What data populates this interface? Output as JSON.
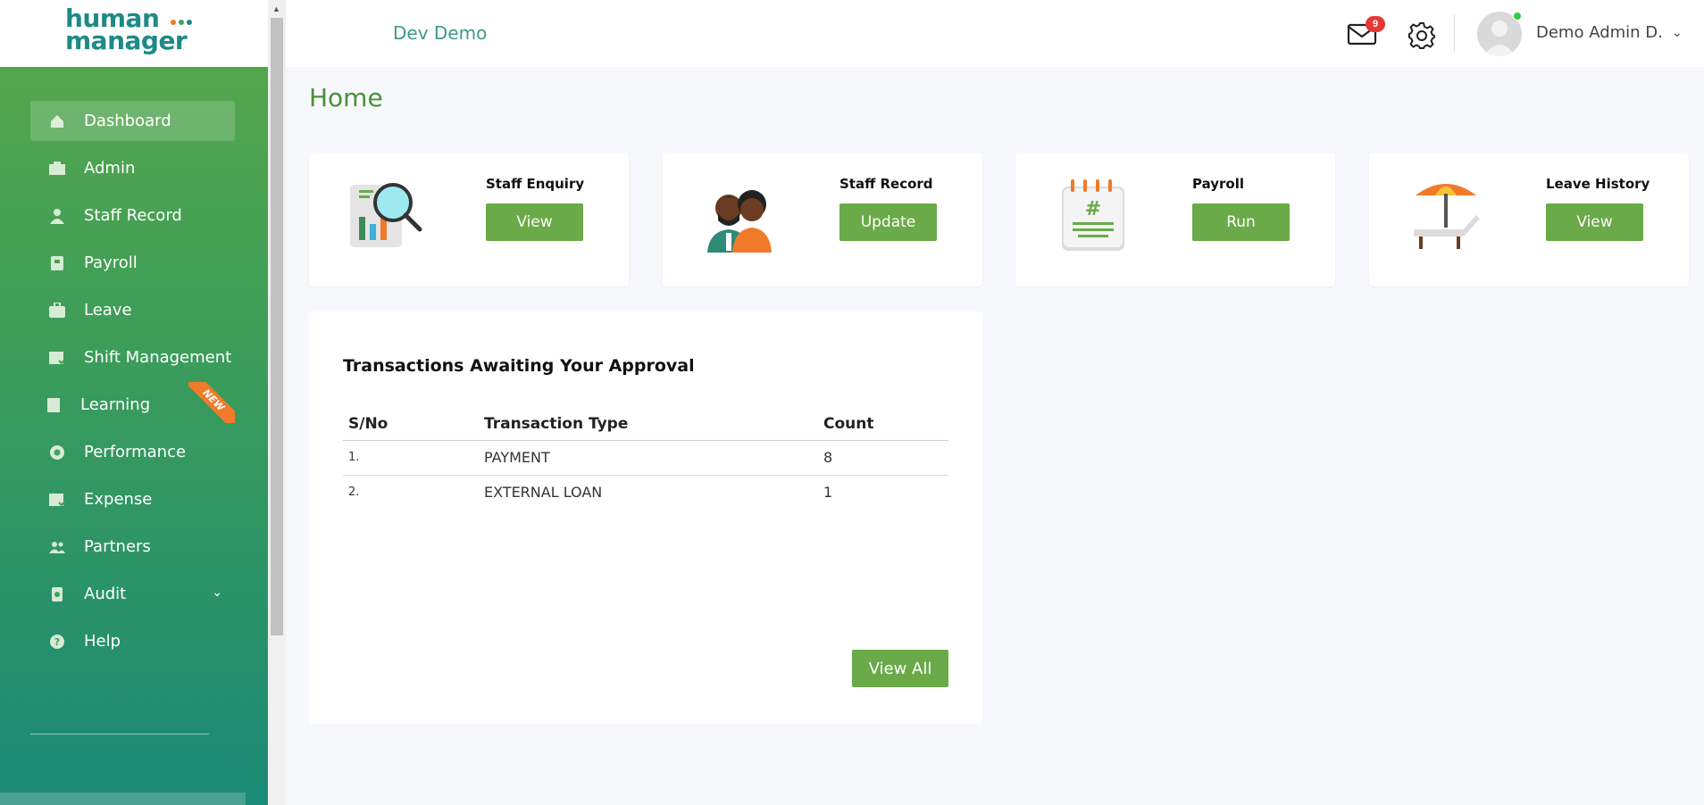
{
  "brand": {
    "line1": "human",
    "line2": "manager",
    "dot_colors": [
      "#f07a2a",
      "#3fa34d",
      "#1d8a87"
    ]
  },
  "topbar": {
    "company": "Dev Demo",
    "mail_count": "9",
    "user_name": "Demo Admin D."
  },
  "sidebar": {
    "items": [
      {
        "label": "Dashboard",
        "icon": "home-icon",
        "active": true
      },
      {
        "label": "Admin",
        "icon": "briefcase-icon"
      },
      {
        "label": "Staff Record",
        "icon": "person-icon"
      },
      {
        "label": "Payroll",
        "icon": "payroll-icon"
      },
      {
        "label": "Leave",
        "icon": "suitcase-icon"
      },
      {
        "label": "Shift Management",
        "icon": "calendar-check-icon"
      },
      {
        "label": "Learning",
        "icon": "book-icon",
        "badge": "NEW"
      },
      {
        "label": "Performance",
        "icon": "performance-icon"
      },
      {
        "label": "Expense",
        "icon": "expense-icon"
      },
      {
        "label": "Partners",
        "icon": "people-icon"
      },
      {
        "label": "Audit",
        "icon": "audit-icon"
      },
      {
        "label": "Help",
        "icon": "help-icon"
      }
    ]
  },
  "page": {
    "title": "Home"
  },
  "cards": [
    {
      "title": "Staff Enquiry",
      "button": "View",
      "icon": "magnifier-chart-icon"
    },
    {
      "title": "Staff Record",
      "button": "Update",
      "icon": "staff-people-icon"
    },
    {
      "title": "Payroll",
      "button": "Run",
      "icon": "calendar-pay-icon"
    },
    {
      "title": "Leave History",
      "button": "View",
      "icon": "beach-chair-icon"
    }
  ],
  "approvals": {
    "title": "Transactions Awaiting Your Approval",
    "columns": [
      "S/No",
      "Transaction Type",
      "Count"
    ],
    "rows": [
      {
        "sn": "1.",
        "type": "PAYMENT",
        "count": "8"
      },
      {
        "sn": "2.",
        "type": "EXTERNAL LOAN",
        "count": "1"
      }
    ],
    "view_all": "View All"
  },
  "colors": {
    "accent_green": "#6aaa48",
    "title_green": "#4a8f3a",
    "teal": "#1d8a87",
    "badge_red": "#e53935"
  }
}
